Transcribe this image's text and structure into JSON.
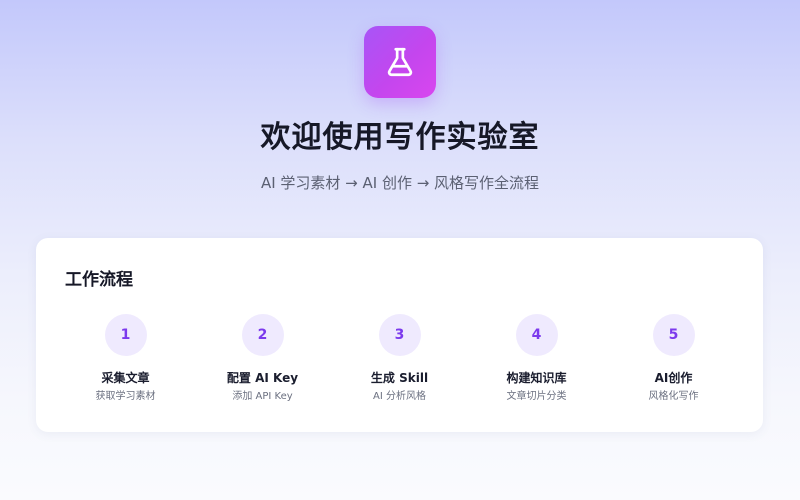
{
  "logo": {
    "icon": "flask-icon"
  },
  "hero": {
    "title": "欢迎使用写作实验室",
    "subtitle": "AI 学习素材 → AI 创作 → 风格写作全流程"
  },
  "workflow": {
    "title": "工作流程",
    "steps": [
      {
        "number": "1",
        "title": "采集文章",
        "desc": "获取学习素材"
      },
      {
        "number": "2",
        "title": "配置 AI Key",
        "desc": "添加 API Key"
      },
      {
        "number": "3",
        "title": "生成 Skill",
        "desc": "AI 分析风格"
      },
      {
        "number": "4",
        "title": "构建知识库",
        "desc": "文章切片分类"
      },
      {
        "number": "5",
        "title": "AI创作",
        "desc": "风格化写作"
      }
    ]
  },
  "colors": {
    "accent": "#a855f7",
    "accent_end": "#d946ef",
    "step_number": "#7c3aed",
    "step_circle_bg": "#efeafe"
  }
}
